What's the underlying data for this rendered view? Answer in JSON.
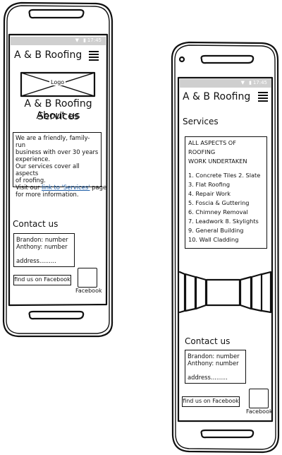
{
  "left_phone": {
    "status": {
      "time": "17:45"
    },
    "header": {
      "title": "A & B Roofing"
    },
    "logo_label": "Logo",
    "heading_line1": "A & B Roofing Services",
    "heading_line2": "About us",
    "about": {
      "line1": "We are a friendly, family-run",
      "line2": "business with over 30 years",
      "line3": "experience.",
      "line4": "Our services cover all aspects",
      "line5": "of roofing.",
      "visit_prefix": "Visit our ",
      "link_text": "link to 'Services'",
      "visit_suffix": " page",
      "line7": "for more information."
    },
    "contact": {
      "title": "Contact us",
      "line1": "Brandon: number",
      "line2": "Anthony: number",
      "line3": "address.........",
      "facebook_button": "find us on Facebook",
      "facebook_caption": "Facebook"
    }
  },
  "right_phone": {
    "status": {
      "time": "17:45"
    },
    "header": {
      "title": "A & B Roofing"
    },
    "services_title": "Services",
    "services_intro": [
      "ALL ASPECTS OF",
      "ROOFING",
      "WORK UNDERTAKEN"
    ],
    "services_items": [
      "1. Concrete Tiles 2. Slate",
      "3. Flat Roofing",
      "4. Repair Work",
      "5. Foscia & Guttering",
      "6. Chimney Removal",
      "7. Leadwork 8. Skylights",
      "9. General Building",
      "10. Wall Cladding"
    ],
    "contact": {
      "title": "Contact us",
      "line1": "Brandon: number",
      "line2": "Anthony: number",
      "line3": "address.........",
      "facebook_button": "find us on Facebook",
      "facebook_caption": "Facebook"
    }
  }
}
